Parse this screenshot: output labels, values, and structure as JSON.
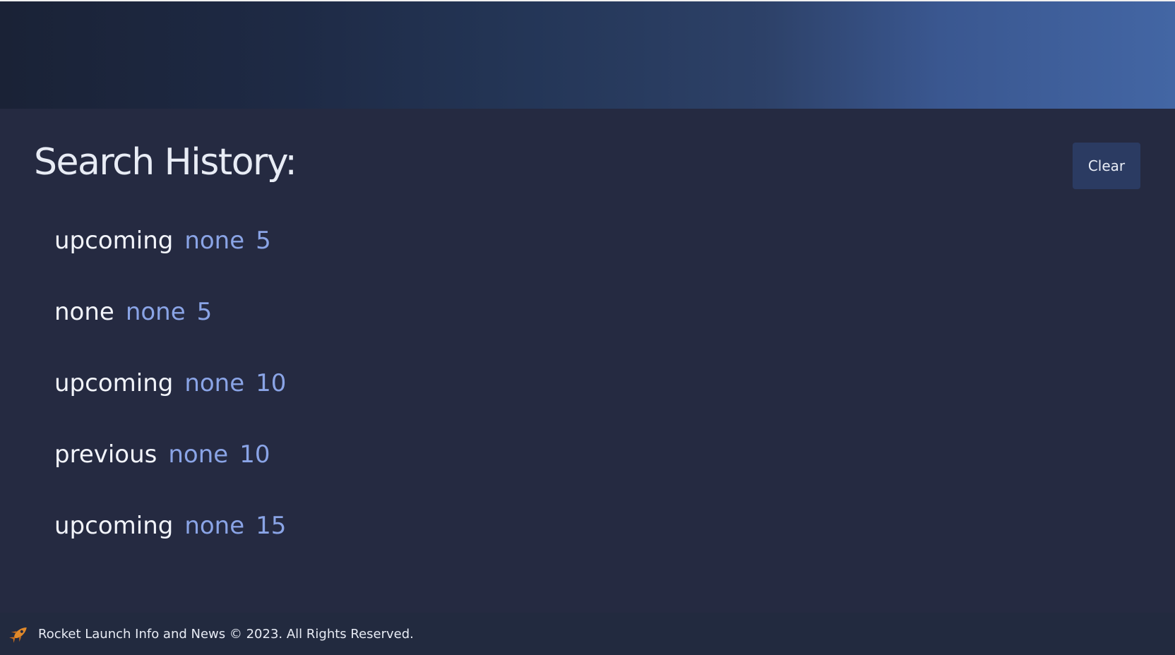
{
  "main": {
    "title": "Search History:",
    "clear_label": "Clear",
    "history": [
      {
        "type": "upcoming",
        "filter": "none",
        "count": "5"
      },
      {
        "type": "none",
        "filter": "none",
        "count": "5"
      },
      {
        "type": "upcoming",
        "filter": "none",
        "count": "10"
      },
      {
        "type": "previous",
        "filter": "none",
        "count": "10"
      },
      {
        "type": "upcoming",
        "filter": "none",
        "count": "15"
      }
    ]
  },
  "footer": {
    "icon": "rocket-icon",
    "text": "Rocket Launch Info and News © 2023. All Rights Reserved."
  },
  "colors": {
    "background": "#252a41",
    "accent": "#8aa4e6",
    "button": "#2b3b62",
    "icon": "#e0892a"
  }
}
